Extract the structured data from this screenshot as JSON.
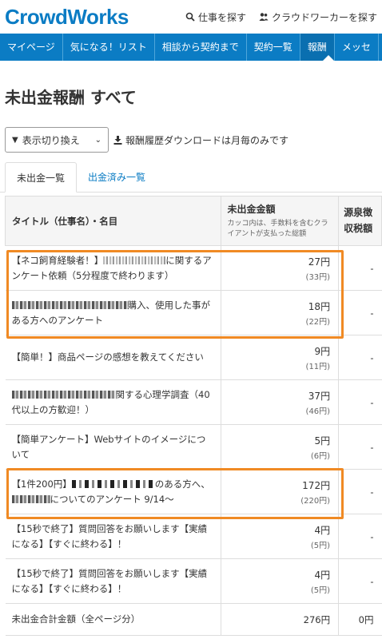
{
  "header": {
    "logo": "CrowdWorks",
    "find_jobs": "仕事を探す",
    "find_workers": "クラウドワーカーを探す"
  },
  "nav": {
    "items": [
      {
        "label": "マイページ"
      },
      {
        "label": "気になる！リスト"
      },
      {
        "label": "相談から契約まで"
      },
      {
        "label": "契約一覧"
      },
      {
        "label": "報酬"
      },
      {
        "label": "メッセ"
      }
    ],
    "active": "報酬"
  },
  "page": {
    "title": "未出金報酬 すべて"
  },
  "controls": {
    "view_select": "表示切り換え",
    "download_note": "報酬履歴ダウンロードは月毎のみです"
  },
  "tabs": [
    {
      "label": "未出金一覧",
      "active": true
    },
    {
      "label": "出金済み一覧",
      "active": false
    }
  ],
  "table": {
    "headers": {
      "title": "タイトル（仕事名）・名目",
      "amount": "未出金金額",
      "amount_note": "カッコ内は、手数料を含むクライアントが支払った総額",
      "tax": "源泉徴収税額"
    },
    "rows": [
      {
        "pre": "【ネコ飼育経験者！】",
        "post": "に関するアンケート依頼（5分程度で終わります）",
        "amount": "27円",
        "gross": "(33円)",
        "tax": "-"
      },
      {
        "pre": "",
        "post": "購入、使用した事がある方へのアンケート",
        "amount": "18円",
        "gross": "(22円)",
        "tax": "-"
      },
      {
        "pre": "",
        "post": "【簡単！】商品ページの感想を教えてください",
        "amount": "9円",
        "gross": "(11円)",
        "tax": "-"
      },
      {
        "pre": "",
        "post": "関する心理学調査（40代以上の方歓迎！）",
        "amount": "37円",
        "gross": "(46円)",
        "tax": "-"
      },
      {
        "pre": "",
        "post": "【簡単アンケート】Webサイトのイメージについて",
        "amount": "5円",
        "gross": "(6円)",
        "tax": "-"
      },
      {
        "pre": "【1件200円】",
        "mid": "のある方へ、",
        "post": "についてのアンケート 9/14〜",
        "amount": "172円",
        "gross": "(220円)",
        "tax": "-"
      },
      {
        "pre": "",
        "post": "【15秒で終了】質問回答をお願いします【実績になる】【すぐに終わる】！",
        "amount": "4円",
        "gross": "(5円)",
        "tax": "-"
      },
      {
        "pre": "",
        "post": "【15秒で終了】質問回答をお願いします【実績になる】【すぐに終わる】！",
        "amount": "4円",
        "gross": "(5円)",
        "tax": "-"
      }
    ],
    "total": {
      "label": "未出金合計金額（全ページ分）",
      "amount": "276円",
      "tax": "0円"
    }
  },
  "colors": {
    "brand": "#0b7cc4",
    "highlight": "#f08a24"
  }
}
